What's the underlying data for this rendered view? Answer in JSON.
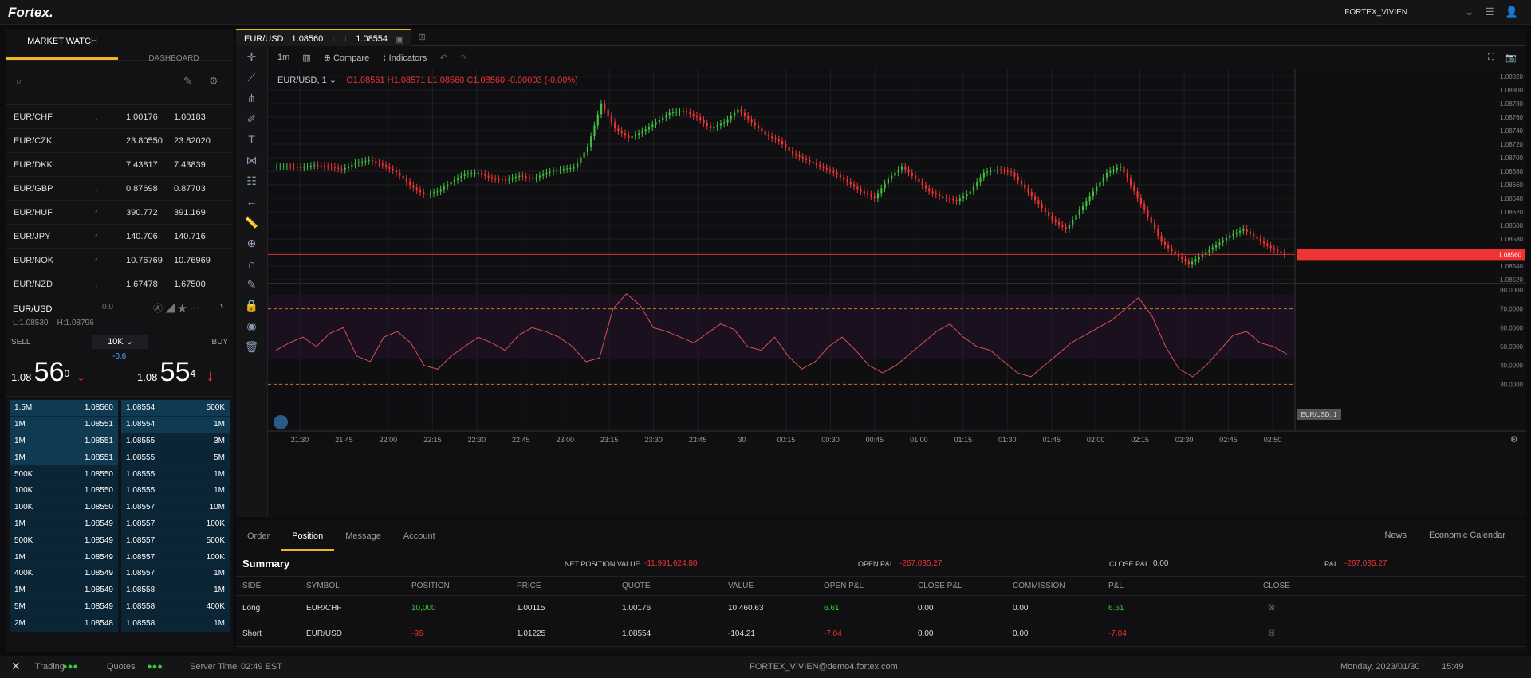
{
  "app": {
    "logo": "Fortex.",
    "user": "FORTEX_VIVIEN"
  },
  "left": {
    "tab_market": "MARKET WATCH",
    "tab_dashboard": "DASHBOARD",
    "watchlist": [
      {
        "sym": "EUR/CHF",
        "dir": "down",
        "bid": "1.00176",
        "ask": "1.00183"
      },
      {
        "sym": "EUR/CZK",
        "dir": "down",
        "bid": "23.80550",
        "ask": "23.82020"
      },
      {
        "sym": "EUR/DKK",
        "dir": "down",
        "bid": "7.43817",
        "ask": "7.43839"
      },
      {
        "sym": "EUR/GBP",
        "dir": "down",
        "bid": "0.87698",
        "ask": "0.87703"
      },
      {
        "sym": "EUR/HUF",
        "dir": "up",
        "bid": "390.772",
        "ask": "391.169"
      },
      {
        "sym": "EUR/JPY",
        "dir": "up",
        "bid": "140.706",
        "ask": "140.716"
      },
      {
        "sym": "EUR/NOK",
        "dir": "up",
        "bid": "10.76769",
        "ask": "10.76969"
      },
      {
        "sym": "EUR/NZD",
        "dir": "down",
        "bid": "1.67478",
        "ask": "1.67500"
      }
    ],
    "selected": {
      "sym": "EUR/USD",
      "change": "0.0",
      "low": "L:1.08530",
      "high": "H:1.08796"
    },
    "trade": {
      "sell": "SELL",
      "buy": "BUY",
      "qty": "10K",
      "spread": "-0.6",
      "sell_pre": "1.08",
      "sell_big": "56",
      "sell_sup": "0",
      "buy_pre": "1.08",
      "buy_big": "55",
      "buy_sup": "4"
    },
    "depth_sell": [
      [
        "1.5M",
        "1.08560"
      ],
      [
        "1M",
        "1.08551"
      ],
      [
        "1M",
        "1.08551"
      ],
      [
        "1M",
        "1.08551"
      ],
      [
        "500K",
        "1.08550"
      ],
      [
        "100K",
        "1.08550"
      ],
      [
        "100K",
        "1.08550"
      ],
      [
        "1M",
        "1.08549"
      ],
      [
        "500K",
        "1.08549"
      ],
      [
        "1M",
        "1.08549"
      ],
      [
        "400K",
        "1.08549"
      ],
      [
        "1M",
        "1.08549"
      ],
      [
        "5M",
        "1.08549"
      ],
      [
        "2M",
        "1.08548"
      ]
    ],
    "depth_buy": [
      [
        "1.08554",
        "500K"
      ],
      [
        "1.08554",
        "1M"
      ],
      [
        "1.08555",
        "3M"
      ],
      [
        "1.08555",
        "5M"
      ],
      [
        "1.08555",
        "1M"
      ],
      [
        "1.08555",
        "1M"
      ],
      [
        "1.08557",
        "10M"
      ],
      [
        "1.08557",
        "100K"
      ],
      [
        "1.08557",
        "500K"
      ],
      [
        "1.08557",
        "100K"
      ],
      [
        "1.08557",
        "1M"
      ],
      [
        "1.08558",
        "1M"
      ],
      [
        "1.08558",
        "400K"
      ],
      [
        "1.08558",
        "1M"
      ]
    ]
  },
  "chart": {
    "tab_sym": "EUR/USD",
    "tab_bid": "1.08560",
    "tab_ask": "1.08554",
    "interval": "1m",
    "compare": "Compare",
    "indicators": "Indicators",
    "ohlc": {
      "label": "EUR/USD, 1",
      "o": "O1.08561",
      "h": "H1.08571",
      "l": "L1.08560",
      "c": "C1.08560",
      "chg": "-0.00003 (-0.00%)"
    },
    "price_label": "1.08560",
    "osc_label": "EUR/USD, 1",
    "chart_data": {
      "type": "candlestick",
      "series": "EUR/USD 1m",
      "xticks": [
        "21:30",
        "21:45",
        "22:00",
        "22:15",
        "22:30",
        "22:45",
        "23:00",
        "23:15",
        "23:30",
        "23:45",
        "30",
        "00:15",
        "00:30",
        "00:45",
        "01:00",
        "01:15",
        "01:30",
        "01:45",
        "02:00",
        "02:15",
        "02:30",
        "02:45",
        "02:50"
      ],
      "yticks": [
        "1.08820",
        "1.08800",
        "1.08780",
        "1.08760",
        "1.08740",
        "1.08720",
        "1.08700",
        "1.08680",
        "1.08660",
        "1.08640",
        "1.08620",
        "1.08600",
        "1.08580",
        "1.08560",
        "1.08540",
        "1.08520"
      ],
      "ylim": [
        1.0852,
        1.0883
      ],
      "close": [
        1.087,
        1.08698,
        1.08702,
        1.087,
        1.08695,
        1.08705,
        1.0871,
        1.08702,
        1.0869,
        1.0867,
        1.08655,
        1.0866,
        1.08675,
        1.08688,
        1.0869,
        1.0868,
        1.08678,
        1.08685,
        1.0868,
        1.0869,
        1.08695,
        1.08698,
        1.0873,
        1.088,
        1.0876,
        1.08745,
        1.08755,
        1.0877,
        1.08785,
        1.08788,
        1.08778,
        1.0876,
        1.0877,
        1.0879,
        1.0877,
        1.0875,
        1.0874,
        1.0872,
        1.0871,
        1.087,
        1.0869,
        1.08675,
        1.0866,
        1.0865,
        1.0868,
        1.087,
        1.0868,
        1.0866,
        1.0865,
        1.08645,
        1.0866,
        1.0869,
        1.08695,
        1.0869,
        1.08665,
        1.0864,
        1.08615,
        1.086,
        1.0863,
        1.0866,
        1.0869,
        1.087,
        1.0866,
        1.0862,
        1.0858,
        1.0856,
        1.08545,
        1.0856,
        1.08575,
        1.0859,
        1.086,
        1.08585,
        1.0857,
        1.0856
      ],
      "osc_type": "line",
      "osc_ylim": [
        20,
        80
      ],
      "osc_yticks": [
        "80.0000",
        "70.0000",
        "60.0000",
        "50.0000",
        "40.0000",
        "30.0000"
      ],
      "osc_bands": [
        70,
        30
      ],
      "osc": [
        48,
        52,
        55,
        50,
        57,
        60,
        45,
        42,
        55,
        58,
        52,
        40,
        38,
        45,
        50,
        55,
        52,
        48,
        56,
        60,
        58,
        55,
        50,
        42,
        44,
        70,
        78,
        72,
        60,
        58,
        55,
        52,
        57,
        62,
        59,
        50,
        48,
        55,
        45,
        38,
        42,
        50,
        55,
        48,
        40,
        36,
        40,
        46,
        52,
        58,
        62,
        55,
        50,
        48,
        42,
        36,
        34,
        40,
        46,
        52,
        56,
        60,
        64,
        70,
        76,
        66,
        50,
        38,
        34,
        40,
        48,
        56,
        58,
        52,
        50,
        46
      ]
    }
  },
  "bottom": {
    "tabs": [
      "Order",
      "Position",
      "Message",
      "Account"
    ],
    "news": "News",
    "calendar": "Economic Calendar",
    "summary": {
      "title": "Summary",
      "npv_label": "NET POSITION VALUE",
      "npv": "-11,991,624.80",
      "open_label": "OPEN P&L",
      "open": "-267,035.27",
      "close_label": "CLOSE P&L",
      "close": "0.00",
      "pl_label": "P&L",
      "pl": "-267,035.27"
    },
    "headers": [
      "SIDE",
      "SYMBOL",
      "POSITION",
      "PRICE",
      "QUOTE",
      "VALUE",
      "OPEN P&L",
      "CLOSE P&L",
      "COMMISSION",
      "P&L",
      "CLOSE"
    ],
    "rows": [
      [
        "Long",
        "EUR/CHF",
        "10,000",
        "1.00115",
        "1.00176",
        "10,460.63",
        "6.61",
        "0.00",
        "0.00",
        "6.61"
      ],
      [
        "Short",
        "EUR/USD",
        "-96",
        "1.01225",
        "1.08554",
        "-104.21",
        "-7.04",
        "0.00",
        "0.00",
        "-7.04"
      ]
    ]
  },
  "status": {
    "trading": "Trading",
    "quotes": "Quotes",
    "server_label": "Server Time",
    "server_time": "02:49 EST",
    "account": "FORTEX_VIVIEN@demo4.fortex.com",
    "date": "Monday, 2023/01/30",
    "time": "15:49"
  }
}
